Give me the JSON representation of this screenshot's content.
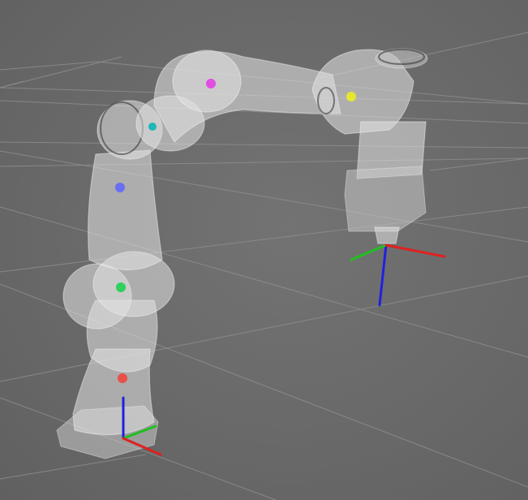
{
  "viewer": {
    "background": "#686868",
    "grid_color": "#8e8e8e"
  },
  "robot": {
    "link_color": "#e3e3e3",
    "joint_markers": [
      {
        "name": "joint1",
        "color": "#e8504a"
      },
      {
        "name": "joint2",
        "color": "#2fd15c"
      },
      {
        "name": "joint3",
        "color": "#6a6ef0"
      },
      {
        "name": "joint4",
        "color": "#1fb7b7"
      },
      {
        "name": "joint5",
        "color": "#e24fe0"
      },
      {
        "name": "joint6",
        "color": "#e6e630"
      }
    ]
  },
  "frames": {
    "base_frame": {
      "x_color": "#e02020",
      "y_color": "#20c020",
      "z_color": "#2020e0"
    },
    "end_effector_frame": {
      "x_color": "#e02020",
      "y_color": "#20c020",
      "z_color": "#2020e0"
    }
  }
}
